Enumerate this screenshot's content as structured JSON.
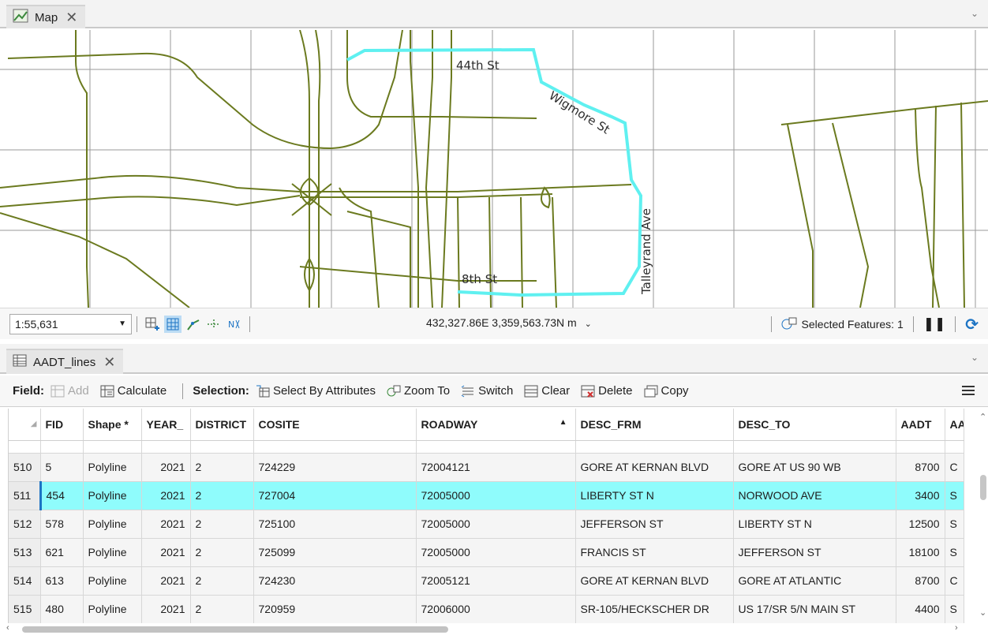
{
  "map_tab": {
    "title": "Map"
  },
  "map": {
    "labels": {
      "street_44th": "44th St",
      "street_wigmore": "Wigmore St",
      "street_8th": "8th St",
      "street_talleyrand": "Talleyrand Ave"
    },
    "colors": {
      "roads": "#6b7a1f",
      "selection": "#5ff0f0",
      "grid": "#9a9a9a"
    }
  },
  "map_status": {
    "scale": "1:55,631",
    "coordinates": "432,327.86E 3,359,563.73N m",
    "selected_features": "Selected Features: 1"
  },
  "table_tab": {
    "title": "AADT_lines"
  },
  "toolbar": {
    "field_label": "Field:",
    "add": "Add",
    "calculate": "Calculate",
    "selection_label": "Selection:",
    "select_by_attributes": "Select By Attributes",
    "zoom_to": "Zoom To",
    "switch": "Switch",
    "clear": "Clear",
    "delete": "Delete",
    "copy": "Copy"
  },
  "table": {
    "columns": [
      "FID",
      "Shape *",
      "YEAR_",
      "DISTRICT",
      "COSITE",
      "ROADWAY",
      "DESC_FRM",
      "DESC_TO",
      "AADT",
      "AAI"
    ],
    "rows": [
      {
        "row": "510",
        "fid": "5",
        "shape": "Polyline",
        "year": "2021",
        "district": "2",
        "cosite": "724229",
        "roadway": "72004121",
        "desc_frm": "GORE AT KERNAN BLVD",
        "desc_to": "GORE AT US 90 WB",
        "aadt": "8700",
        "aai": "C"
      },
      {
        "row": "511",
        "fid": "454",
        "shape": "Polyline",
        "year": "2021",
        "district": "2",
        "cosite": "727004",
        "roadway": "72005000",
        "desc_frm": "LIBERTY ST N",
        "desc_to": "NORWOOD AVE",
        "aadt": "3400",
        "aai": "S"
      },
      {
        "row": "512",
        "fid": "578",
        "shape": "Polyline",
        "year": "2021",
        "district": "2",
        "cosite": "725100",
        "roadway": "72005000",
        "desc_frm": "JEFFERSON ST",
        "desc_to": "LIBERTY ST N",
        "aadt": "12500",
        "aai": "S"
      },
      {
        "row": "513",
        "fid": "621",
        "shape": "Polyline",
        "year": "2021",
        "district": "2",
        "cosite": "725099",
        "roadway": "72005000",
        "desc_frm": "FRANCIS ST",
        "desc_to": "JEFFERSON ST",
        "aadt": "18100",
        "aai": "S"
      },
      {
        "row": "514",
        "fid": "613",
        "shape": "Polyline",
        "year": "2021",
        "district": "2",
        "cosite": "724230",
        "roadway": "72005121",
        "desc_frm": "GORE AT KERNAN BLVD",
        "desc_to": "GORE AT ATLANTIC",
        "aadt": "8700",
        "aai": "C"
      },
      {
        "row": "515",
        "fid": "480",
        "shape": "Polyline",
        "year": "2021",
        "district": "2",
        "cosite": "720959",
        "roadway": "72006000",
        "desc_frm": "SR-105/HECKSCHER DR",
        "desc_to": "US 17/SR 5/N MAIN ST",
        "aadt": "4400",
        "aai": "S"
      }
    ],
    "selected_row": "511"
  }
}
